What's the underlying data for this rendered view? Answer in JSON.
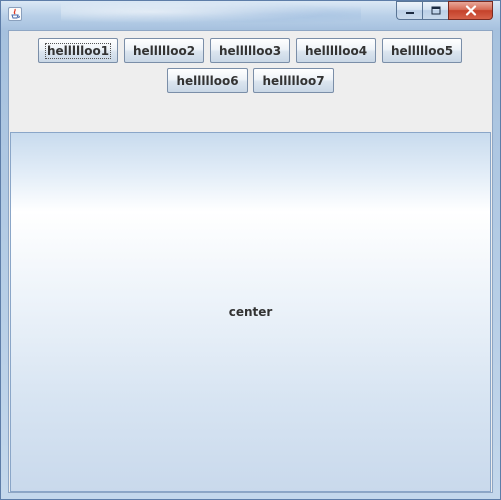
{
  "window": {
    "icon": "java-cup-icon",
    "controls": {
      "minimize_icon": "minimize-icon",
      "maximize_icon": "maximize-icon",
      "close_icon": "close-icon"
    }
  },
  "north_buttons": [
    {
      "label": "hellllloo1",
      "focused": true
    },
    {
      "label": "hellllloo2"
    },
    {
      "label": "hellllloo3"
    },
    {
      "label": "hellllloo4"
    },
    {
      "label": "hellllloo5"
    },
    {
      "label": "hellllloo6"
    },
    {
      "label": "hellllloo7"
    }
  ],
  "center": {
    "label": "center"
  },
  "colors": {
    "titlebar": "#b9d0e8",
    "close_button": "#c4412a",
    "client_background": "#eeeeee",
    "text": "#333333"
  }
}
